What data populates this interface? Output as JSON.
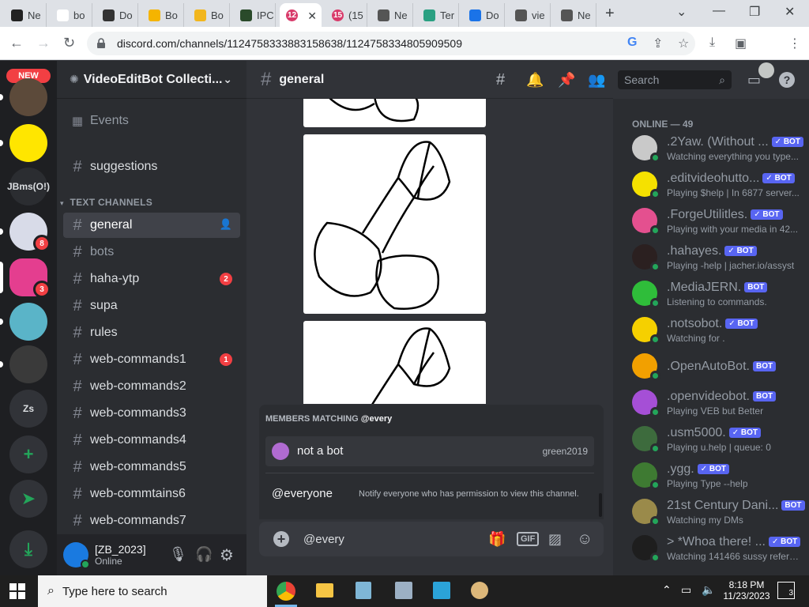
{
  "browser": {
    "tabs": [
      {
        "label": "Ne",
        "icon": "library-icon"
      },
      {
        "label": "bo",
        "icon": "google-icon"
      },
      {
        "label": "Do",
        "icon": "document-icon"
      },
      {
        "label": "Bo",
        "icon": "bookmark-icon"
      },
      {
        "label": "Bo",
        "icon": "g-icon"
      },
      {
        "label": "IPC",
        "icon": "ipc-icon"
      },
      {
        "label": "",
        "icon": "discord-icon",
        "badge": "12"
      },
      {
        "label": "(15",
        "icon": "discord-icon",
        "badge": "15"
      },
      {
        "label": "Ne",
        "icon": "globe-icon"
      },
      {
        "label": "Ter",
        "icon": "terminal-icon"
      },
      {
        "label": "Do",
        "icon": "download-icon"
      },
      {
        "label": "vie",
        "icon": "globe-icon"
      },
      {
        "label": "Ne",
        "icon": "globe-icon"
      }
    ],
    "url": "discord.com/channels/1124758333883158638/1124758334805909509"
  },
  "servers": {
    "new_label": "NEW",
    "items": [
      {
        "text": "",
        "color": "#5c4a3a",
        "kind": "food"
      },
      {
        "text": "",
        "color": "#ffe600",
        "kind": "roblox"
      },
      {
        "text": "JBms(O!)",
        "color": "#2b2d31",
        "kind": "text"
      },
      {
        "text": "",
        "color": "#d8dbe8",
        "kind": "anime",
        "badge": "8"
      },
      {
        "text": "",
        "color": "#e43e8f",
        "kind": "videoedit",
        "badge": "3"
      },
      {
        "text": "",
        "color": "#5ab4c8",
        "kind": "blob"
      },
      {
        "text": "",
        "color": "#3a3a3a",
        "kind": "cat"
      },
      {
        "text": "Zs",
        "color": "#313338",
        "kind": "text"
      }
    ]
  },
  "guild": {
    "name": "VideoEditBot Collecti...",
    "events_label": "Events",
    "category": "TEXT CHANNELS",
    "channels": [
      {
        "name": "suggestions",
        "state": "normal"
      },
      {
        "name": "general",
        "state": "selected"
      },
      {
        "name": "bots",
        "state": "muted"
      },
      {
        "name": "haha-ytp",
        "state": "normal",
        "badge": "2"
      },
      {
        "name": "supa",
        "state": "normal"
      },
      {
        "name": "rules",
        "state": "normal"
      },
      {
        "name": "web-commands1",
        "state": "normal",
        "badge": "1"
      },
      {
        "name": "web-commands2",
        "state": "normal"
      },
      {
        "name": "web-commands3",
        "state": "normal"
      },
      {
        "name": "web-commands4",
        "state": "normal"
      },
      {
        "name": "web-commands5",
        "state": "normal"
      },
      {
        "name": "web-commtains6",
        "state": "normal"
      },
      {
        "name": "web-commands7",
        "state": "normal"
      }
    ]
  },
  "user": {
    "name": "[ZB_2023]",
    "status": "Online"
  },
  "chat": {
    "channel": "general",
    "search_placeholder": "Search",
    "input_value": "@every",
    "popup": {
      "header_prefix": "MEMBERS MATCHING ",
      "header_query": "@every",
      "member_name": "not a bot",
      "member_username": "green2019",
      "everyone_label": "@everyone",
      "everyone_desc": "Notify everyone who has permission to view this channel."
    }
  },
  "members": {
    "header": "ONLINE — 49",
    "bot_label": "BOT",
    "list": [
      {
        "name": ".2Yaw. (Without ...",
        "activity": "Watching everything you type...",
        "verified": true,
        "color": "#c9c9c9"
      },
      {
        "name": ".editvideohutto...",
        "activity": "Playing $help | In 6877 server...",
        "verified": true,
        "color": "#f5e100"
      },
      {
        "name": ".ForgeUtilitles.",
        "activity": "Playing with your media in 42...",
        "verified": true,
        "color": "#e4508f"
      },
      {
        "name": ".hahayes.",
        "activity": "Playing -help | jacher.io/assyst",
        "verified": true,
        "color": "#2b2020"
      },
      {
        "name": ".MediaJERN.",
        "activity": "Listening to commands.",
        "verified": false,
        "color": "#2fbd3a"
      },
      {
        "name": ".notsobot.",
        "activity": "Watching for .",
        "verified": true,
        "color": "#f5d000"
      },
      {
        "name": ".OpenAutoBot.",
        "activity": "",
        "verified": false,
        "color": "#f2a000"
      },
      {
        "name": ".openvideobot.",
        "activity": "Playing VEB but Better",
        "verified": false,
        "color": "#a54fd6"
      },
      {
        "name": ".usm5000.",
        "activity": "Playing u.help | queue: 0",
        "verified": true,
        "color": "#3d6b3d"
      },
      {
        "name": ".ygg.",
        "activity": "Playing Type --help",
        "verified": true,
        "color": "#3e7a32"
      },
      {
        "name": "21st Century Dani...",
        "activity": "Watching my DMs",
        "verified": false,
        "color": "#9a8a4a"
      },
      {
        "name": "> *Whoa there! ...",
        "activity": "Watching 141466 sussy refere...",
        "verified": true,
        "color": "#1e1e1e"
      }
    ]
  },
  "taskbar": {
    "search_placeholder": "Type here to search",
    "time": "8:18 PM",
    "date": "11/23/2023",
    "notif_count": "3"
  }
}
